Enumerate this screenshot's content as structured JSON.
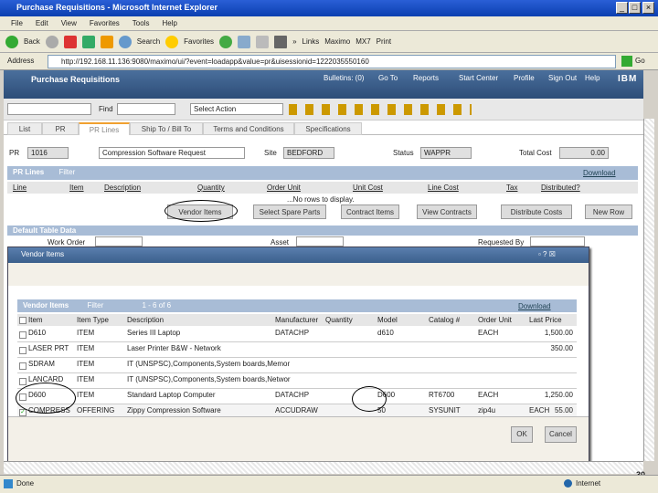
{
  "window": {
    "title": "Purchase Requisitions - Microsoft Internet Explorer",
    "min": "_",
    "max": "□",
    "close": "×"
  },
  "menu": [
    "File",
    "Edit",
    "View",
    "Favorites",
    "Tools",
    "Help"
  ],
  "toolbar": {
    "back": "Back",
    "search": "Search",
    "favorites": "Favorites",
    "links": "Links",
    "link_items": [
      "Maximo",
      "MX7",
      "Print"
    ],
    "more": "»"
  },
  "address": {
    "label": "Address",
    "url": "http://192.168.11.136:9080/maximo/ui/?event=loadapp&value=pr&uisessionid=1222035550160",
    "go": "Go"
  },
  "app": {
    "title": "Purchase Requisitions",
    "nav": [
      "Bulletins: (0)",
      "Go To",
      "Reports",
      "Start Center",
      "Profile",
      "Sign Out",
      "Help"
    ],
    "logo": "IBM"
  },
  "findbar": {
    "find_label": "Find",
    "select_action": "Select Action"
  },
  "tabs": [
    "List",
    "PR",
    "PR Lines",
    "Ship To / Bill To",
    "Terms and Conditions",
    "Specifications"
  ],
  "form": {
    "pr_label": "PR",
    "pr_value": "1016",
    "description": "Compression Software Request",
    "site_label": "Site",
    "site_value": "BEDFORD",
    "status_label": "Status",
    "status_value": "WAPPR",
    "total_label": "Total Cost",
    "total_value": "0.00"
  },
  "pr_lines": {
    "title": "PR Lines",
    "filter": "Filter",
    "download": "Download",
    "columns": [
      "Line",
      "Item",
      "Description",
      "Quantity",
      "Order Unit",
      "Unit Cost",
      "Line Cost",
      "Tax",
      "Distributed?"
    ],
    "empty": "...No rows to display.",
    "buttons": [
      "Vendor Items",
      "Select Spare Parts",
      "Contract Items",
      "View Contracts",
      "Distribute Costs",
      "New Row"
    ]
  },
  "defaults": {
    "title": "Default Table Data",
    "work_order": "Work Order",
    "asset": "Asset",
    "requested_by": "Requested By"
  },
  "dialog": {
    "title": "Vendor Items",
    "table_title": "Vendor Items",
    "filter": "Filter",
    "paging": "1 - 6 of 6",
    "download": "Download",
    "columns": [
      "Item",
      "Item Type",
      "Description",
      "Manufacturer",
      "Quantity",
      "Model",
      "Catalog #",
      "Order Unit",
      "Last Price"
    ],
    "rows": [
      {
        "checked": false,
        "cells": [
          "D610",
          "ITEM",
          "Series III Laptop",
          "DATACHP",
          "",
          "d610",
          "",
          "EACH",
          "1,500.00"
        ]
      },
      {
        "checked": false,
        "cells": [
          "LASER PRT",
          "ITEM",
          "Laser Printer B&W - Network",
          "",
          "",
          "",
          "",
          "",
          "350.00"
        ]
      },
      {
        "checked": false,
        "cells": [
          "SDRAM",
          "ITEM",
          "IT (UNSPSC),Components,System boards,Memor",
          "",
          "",
          "",
          "",
          "",
          ""
        ]
      },
      {
        "checked": false,
        "cells": [
          "LANCARD",
          "ITEM",
          "IT (UNSPSC),Components,System boards,Networ",
          "",
          "",
          "",
          "",
          "",
          ""
        ]
      },
      {
        "checked": false,
        "cells": [
          "D600",
          "ITEM",
          "Standard Laptop Computer",
          "DATACHP",
          "",
          "D600",
          "RT6700",
          "EACH",
          "1,250.00"
        ]
      },
      {
        "checked": true,
        "cells": [
          "COMPRESS",
          "OFFERING",
          "Zippy Compression Software",
          "ACCUDRAW",
          "",
          "50",
          "SYSUNIT",
          "zip4u",
          "EACH",
          "55.00"
        ]
      }
    ],
    "ok": "OK",
    "cancel": "Cancel"
  },
  "statusbar": {
    "text": "Done",
    "zone": "Internet",
    "page_number": "30"
  }
}
